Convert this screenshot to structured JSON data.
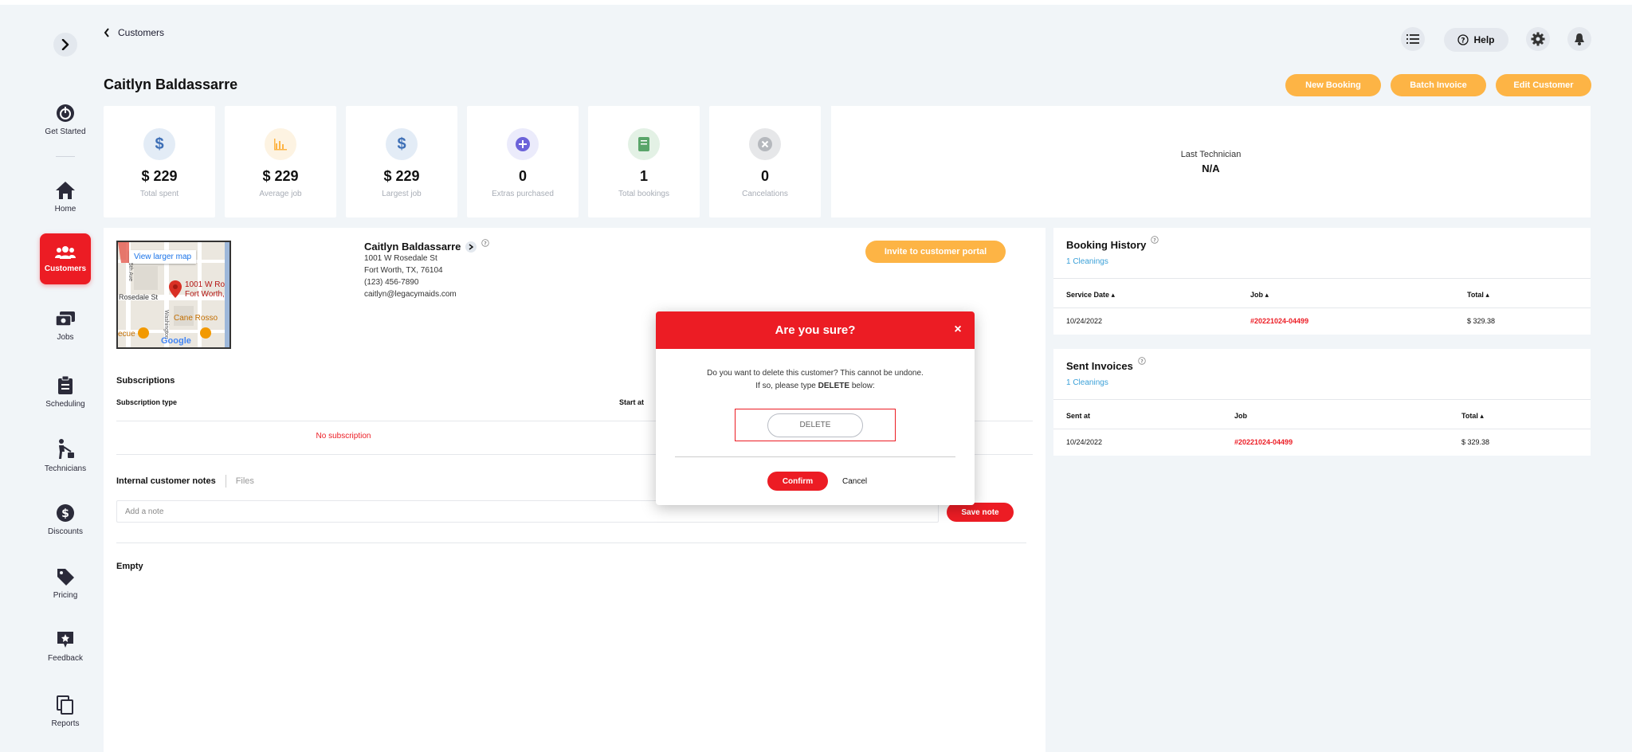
{
  "breadcrumb": {
    "label": "Customers"
  },
  "page": {
    "title": "Caitlyn Baldassarre"
  },
  "header": {
    "help_label": "Help",
    "new_booking": "New Booking",
    "batch_invoice": "Batch Invoice",
    "edit_customer": "Edit Customer"
  },
  "sidebar": {
    "items": [
      {
        "label": "Get Started",
        "icon": "power-icon"
      },
      {
        "label": "Home",
        "icon": "home-icon"
      },
      {
        "label": "Customers",
        "icon": "users-icon",
        "active": true
      },
      {
        "label": "Jobs",
        "icon": "jobs-icon"
      },
      {
        "label": "Scheduling",
        "icon": "clipboard-icon"
      },
      {
        "label": "Technicians",
        "icon": "cleaner-icon"
      },
      {
        "label": "Discounts",
        "icon": "dollar-circle-icon"
      },
      {
        "label": "Pricing",
        "icon": "tag-icon"
      },
      {
        "label": "Feedback",
        "icon": "feedback-icon"
      },
      {
        "label": "Reports",
        "icon": "copy-icon"
      }
    ]
  },
  "stats": [
    {
      "value": "$ 229",
      "caption": "Total spent"
    },
    {
      "value": "$ 229",
      "caption": "Average job"
    },
    {
      "value": "$ 229",
      "caption": "Largest job"
    },
    {
      "value": "0",
      "caption": "Extras purchased"
    },
    {
      "value": "1",
      "caption": "Total bookings"
    },
    {
      "value": "0",
      "caption": "Cancelations"
    }
  ],
  "last_technician": {
    "label": "Last Technician",
    "value": "N/A"
  },
  "customer": {
    "name": "Caitlyn Baldassarre",
    "address1": "1001 W Rosedale St",
    "address2": "Fort Worth, TX, 76104",
    "phone": "(123) 456-7890",
    "email": "caitlyn@legacymaids.com",
    "invite_label": "Invite to customer portal"
  },
  "map": {
    "view_larger": "View larger map",
    "marker_label_1": "1001 W Ro",
    "marker_label_2": "Fort Worth,",
    "street_1": "Rosedale St",
    "street_2": "5th Ave",
    "street_3": "Washington",
    "place_1": "Cane Rosso",
    "place_2": "ecue",
    "google": "Google"
  },
  "subscriptions": {
    "title": "Subscriptions",
    "col_type": "Subscription type",
    "col_start": "Start at",
    "empty": "No subscription"
  },
  "notes": {
    "tab_notes": "Internal customer notes",
    "tab_files": "Files",
    "placeholder": "Add a note",
    "save_label": "Save note",
    "empty": "Empty"
  },
  "booking_history": {
    "title": "Booking History",
    "subtitle": "1 Cleanings",
    "columns": [
      "Service Date",
      "Job",
      "Total"
    ],
    "rows": [
      {
        "date": "10/24/2022",
        "job": "#20221024-04499",
        "total": "$ 329.38"
      }
    ]
  },
  "sent_invoices": {
    "title": "Sent Invoices",
    "subtitle": "1 Cleanings",
    "columns": [
      "Sent at",
      "Job",
      "Total"
    ],
    "rows": [
      {
        "date": "10/24/2022",
        "job": "#20221024-04499",
        "total": "$ 329.38"
      }
    ]
  },
  "modal": {
    "title": "Are you sure?",
    "close": "×",
    "line1": "Do you want to delete this customer? This cannot be undone.",
    "line2_pre": "If so, please type ",
    "line2_bold": "DELETE",
    "line2_post": " below:",
    "input_placeholder": "DELETE",
    "confirm": "Confirm",
    "cancel": "Cancel"
  },
  "colors": {
    "brand_red": "#ec1c24",
    "accent_orange": "#fdb445",
    "background": "#f1f5f8"
  }
}
